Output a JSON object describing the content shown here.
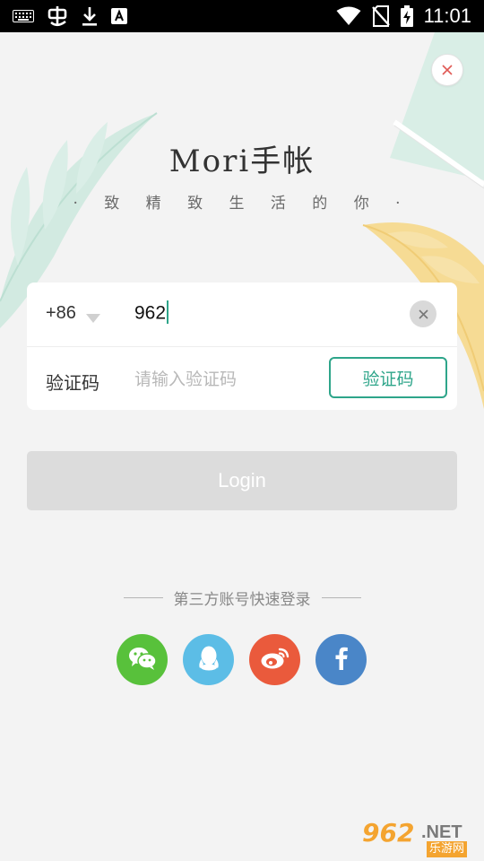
{
  "status_bar": {
    "time": "11:01",
    "left_icons": [
      "keyboard-icon",
      "bug-icon",
      "download-icon",
      "a-box-icon"
    ],
    "right_icons": [
      "wifi-icon",
      "no-sim-icon",
      "battery-charging-icon"
    ]
  },
  "header": {
    "title": "Mori手帐",
    "slogan": "· 致 精 致 生 活 的 你 ·"
  },
  "form": {
    "country_code": "+86",
    "phone_value": "962",
    "code_label": "验证码",
    "code_placeholder": "请输入验证码",
    "code_button": "验证码"
  },
  "login": {
    "label": "Login"
  },
  "third_party": {
    "title": "第三方账号快速登录",
    "providers": [
      "wechat",
      "qq",
      "weibo",
      "facebook"
    ]
  },
  "watermark": {
    "number": "962",
    "suffix": ".NET",
    "sub": "乐游网"
  },
  "colors": {
    "accent": "#2ea58a",
    "background": "#f3f3f3",
    "login_disabled": "#dcdcdc",
    "wechat": "#58c13b",
    "qq": "#5cbde6",
    "weibo": "#ea5a3c",
    "facebook": "#4a86c8"
  }
}
